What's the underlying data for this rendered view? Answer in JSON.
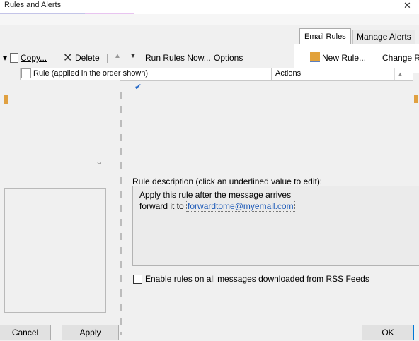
{
  "window": {
    "title": "Rules and Alerts",
    "close_glyph": "✕"
  },
  "tabs": [
    {
      "label": "Email Rules"
    },
    {
      "label": "Manage Alerts"
    }
  ],
  "toolbar": {
    "copy_label": "Copy...",
    "delete_label": "Delete",
    "run_label": "Run Rules Now...",
    "options_label": "Options",
    "new_rule_label": "New Rule...",
    "change_rule_label": "Change Rule"
  },
  "list": {
    "col_rule": "Rule (applied in the order shown)",
    "col_actions": "Actions"
  },
  "description": {
    "label": "Rule description (click an underlined value to edit):",
    "line1": "Apply this rule after the message arrives",
    "line2_prefix": "forward it to ",
    "line2_link": "forwardtome@myemail.com"
  },
  "rss": {
    "label": "Enable rules on all messages downloaded from RSS Feeds",
    "checked": false
  },
  "buttons": {
    "cancel": "Cancel",
    "apply": "Apply",
    "ok": "OK"
  },
  "icons": {
    "check": "✔",
    "chevron_down": "⌄",
    "delete_x": "✕",
    "up": "▲",
    "down": "▼"
  },
  "colors": {
    "link": "#1f5bb8",
    "accent": "#0078d7"
  }
}
